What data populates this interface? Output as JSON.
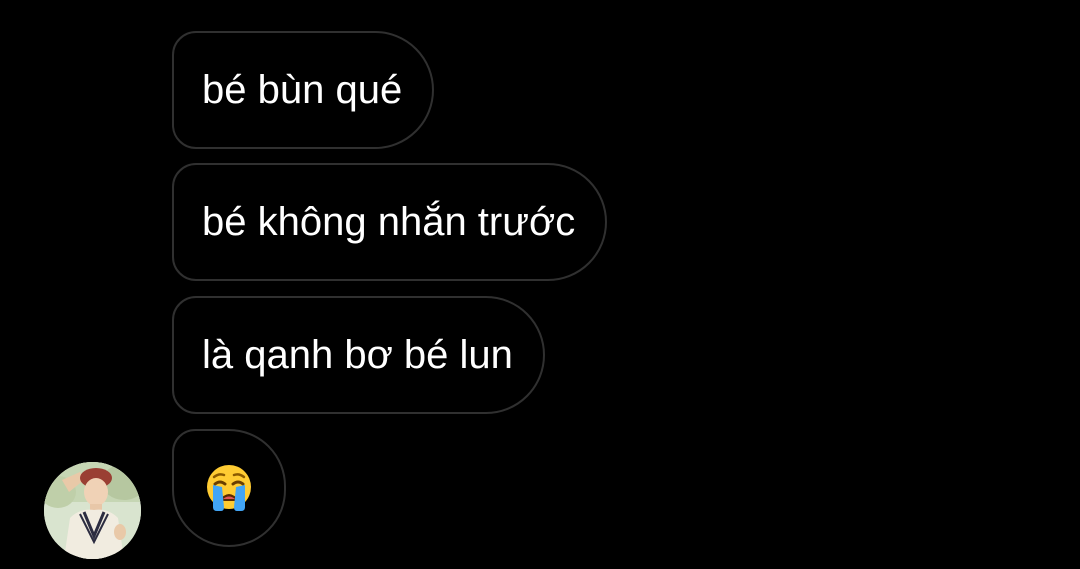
{
  "messages": [
    {
      "text": "bé bùn qué"
    },
    {
      "text": "bé không nhắn trước"
    },
    {
      "text": "là qanh bơ bé lun"
    },
    {
      "emoji": "loudly-crying-face"
    }
  ],
  "sender": {
    "avatar_icon": "person-photo-avatar"
  },
  "colors": {
    "background": "#000000",
    "bubble_border": "#303030",
    "text": "#ffffff"
  }
}
